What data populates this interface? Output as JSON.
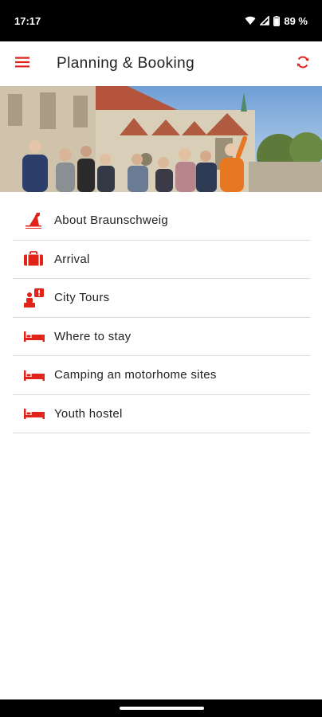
{
  "status_bar": {
    "time": "17:17",
    "battery": "89 %",
    "icons": [
      "wifi-icon",
      "signal-icon",
      "battery-icon"
    ]
  },
  "app_bar": {
    "title": "Planning & Booking",
    "menu_icon": "hamburger-menu-icon",
    "refresh_icon": "refresh-icon"
  },
  "colors": {
    "accent": "#e2231a",
    "text": "#222222",
    "divider": "#dcdcdc"
  },
  "hero": {
    "description_icon": "city-tour-photo"
  },
  "menu": {
    "items": [
      {
        "label": "About Braunschweig",
        "icon": "landmark-icon"
      },
      {
        "label": "Arrival",
        "icon": "suitcase-icon"
      },
      {
        "label": "City Tours",
        "icon": "guide-tour-icon"
      },
      {
        "label": "Where to stay",
        "icon": "bed-icon"
      },
      {
        "label": "Camping an motorhome sites",
        "icon": "bed-icon"
      },
      {
        "label": "Youth hostel",
        "icon": "bed-icon"
      }
    ]
  }
}
